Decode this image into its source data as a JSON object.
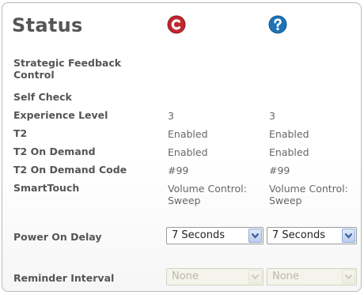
{
  "title": "Status",
  "columns": [
    {
      "icon": "red-c-icon",
      "color": "#c0282e"
    },
    {
      "icon": "blue-question-icon",
      "color": "#1e73b8"
    }
  ],
  "rows": [
    {
      "label": "Strategic Feedback Control",
      "col1": "",
      "col2": ""
    },
    {
      "label": "Self Check",
      "col1": "",
      "col2": ""
    },
    {
      "label": "Experience Level",
      "col1": "3",
      "col2": "3"
    },
    {
      "label": "T2",
      "col1": "Enabled",
      "col2": "Enabled"
    },
    {
      "label": "T2 On Demand",
      "col1": "Enabled",
      "col2": "Enabled"
    },
    {
      "label": "T2 On Demand Code",
      "col1": "#99",
      "col2": "#99"
    },
    {
      "label": "SmartTouch",
      "col1": "Volume Control: Sweep",
      "col2": "Volume Control: Sweep"
    }
  ],
  "power_on_delay": {
    "label": "Power On Delay",
    "col1": "7 Seconds",
    "col2": "7 Seconds"
  },
  "reminder_interval": {
    "label": "Reminder Interval",
    "col1": "None",
    "col2": "None"
  }
}
